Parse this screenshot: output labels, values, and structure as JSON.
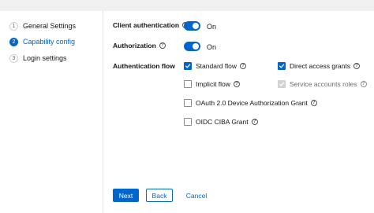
{
  "wizard": {
    "steps": [
      {
        "number": "1",
        "label": "General Settings",
        "current": false
      },
      {
        "number": "2",
        "label": "Capability config",
        "current": true
      },
      {
        "number": "3",
        "label": "Login settings",
        "current": false
      }
    ]
  },
  "form": {
    "client_authentication": {
      "label": "Client authentication",
      "state_text": "On",
      "enabled": true
    },
    "authorization": {
      "label": "Authorization",
      "state_text": "On",
      "enabled": true
    },
    "authentication_flow": {
      "label": "Authentication flow",
      "options": [
        {
          "label": "Standard flow",
          "checked": true,
          "disabled": false
        },
        {
          "label": "Direct access grants",
          "checked": true,
          "disabled": false
        },
        {
          "label": "Implicit flow",
          "checked": false,
          "disabled": false
        },
        {
          "label": "Service accounts roles",
          "checked": true,
          "disabled": true
        },
        {
          "label": "OAuth 2.0 Device Authorization Grant",
          "checked": false,
          "disabled": false
        },
        {
          "label": "OIDC CIBA Grant",
          "checked": false,
          "disabled": false
        }
      ]
    }
  },
  "footer": {
    "next_label": "Next",
    "back_label": "Back",
    "cancel_label": "Cancel"
  },
  "colors": {
    "accent": "#0066cc",
    "disabled_check": "#d2d2d2"
  },
  "icons": {
    "help": "question-circle-icon",
    "check": "checkmark-icon"
  }
}
